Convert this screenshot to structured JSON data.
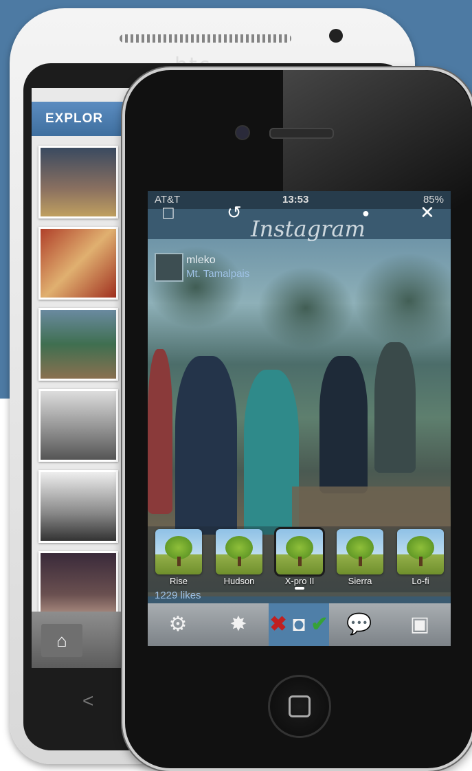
{
  "htc": {
    "brand": "htc",
    "explore_title": "EXPLOR",
    "home_icon": "home-icon",
    "back_icon": "<"
  },
  "iphone": {
    "status": {
      "carrier": "AT&T",
      "wifi_icon": "wifi-icon",
      "time": "13:53",
      "battery": "85%"
    },
    "toolbar_top": {
      "crop": "□",
      "rotate": "↺",
      "drop": "●",
      "close": "✕"
    },
    "app_title": "Instagram",
    "post": {
      "username": "mleko",
      "location": "Mt. Tamalpais",
      "likes": "1229 likes"
    },
    "filters": [
      {
        "label": "Rise"
      },
      {
        "label": "Hudson"
      },
      {
        "label": "X-pro II"
      },
      {
        "label": "Sierra"
      },
      {
        "label": "Lo-fi"
      }
    ],
    "bottom_toolbar": {
      "settings": "⚙",
      "sun": "✸",
      "cancel": "✖",
      "camera": "◘",
      "confirm": "✔",
      "comment": "💬",
      "frame": "▣"
    }
  }
}
